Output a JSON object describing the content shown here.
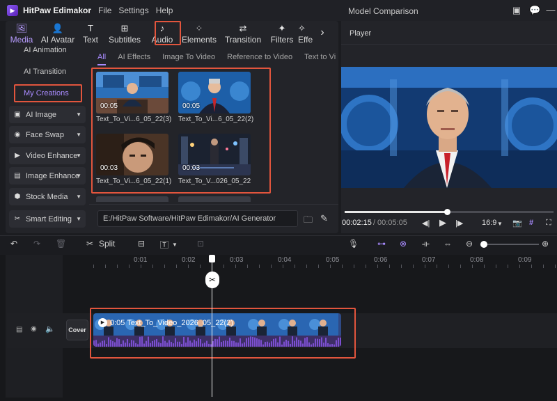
{
  "app": {
    "name": "HitPaw Edimakor",
    "window_title": "Model Comparison"
  },
  "menu": [
    "File",
    "Settings",
    "Help"
  ],
  "toolbar": [
    {
      "label": "Media",
      "icon": "image-icon"
    },
    {
      "label": "AI Avatar",
      "icon": "avatar-icon"
    },
    {
      "label": "Text",
      "icon": "text-icon"
    },
    {
      "label": "Subtitles",
      "icon": "subtitles-icon"
    },
    {
      "label": "Audio",
      "icon": "music-note-icon"
    },
    {
      "label": "Elements",
      "icon": "elements-icon"
    },
    {
      "label": "Transition",
      "icon": "transition-icon"
    },
    {
      "label": "Filters",
      "icon": "filters-icon"
    },
    {
      "label": "Effe",
      "icon": "effects-icon"
    }
  ],
  "sidebar": {
    "text_items": [
      "AI Animation",
      "AI Transition"
    ],
    "selected": "My Creations",
    "buttons": [
      "AI Image",
      "Face Swap",
      "Video Enhance",
      "Image Enhance",
      "Stock Media",
      "Smart Editing"
    ]
  },
  "tabs": [
    "All",
    "AI Effects",
    "Image To Video",
    "Reference to Video",
    "Text to Vi"
  ],
  "media": [
    {
      "duration": "00:05",
      "name": "Text_To_Vi...6_05_22(3)"
    },
    {
      "duration": "00:05",
      "name": "Text_To_Vi...6_05_22(2)"
    },
    {
      "duration": "00:03",
      "name": "Text_To_Vi...6_05_22(1)"
    },
    {
      "duration": "00:03",
      "name": "Text_To_V...026_05_22"
    }
  ],
  "path": "E:/HitPaw Software/HitPaw Edimakor/AI Generator",
  "player": {
    "label": "Player",
    "current": "00:02:15",
    "separator": "/",
    "total": "00:05:05",
    "aspect": "16:9",
    "progress": 0.49
  },
  "timeline_toolbar": {
    "split_label": "Split"
  },
  "ruler": [
    "0:01",
    "0:02",
    "0:03",
    "0:04",
    "0:05",
    "0:06",
    "0:07",
    "0:08",
    "0:09"
  ],
  "track": {
    "cover_label": "Cover",
    "clip_title": "0:05  Text_To_Video_2026_05_22(2)"
  },
  "colors": {
    "accent": "#a98bff",
    "highlight": "#e2553d",
    "clip": "#2f4a86",
    "waveform": "#7c4fd0"
  }
}
